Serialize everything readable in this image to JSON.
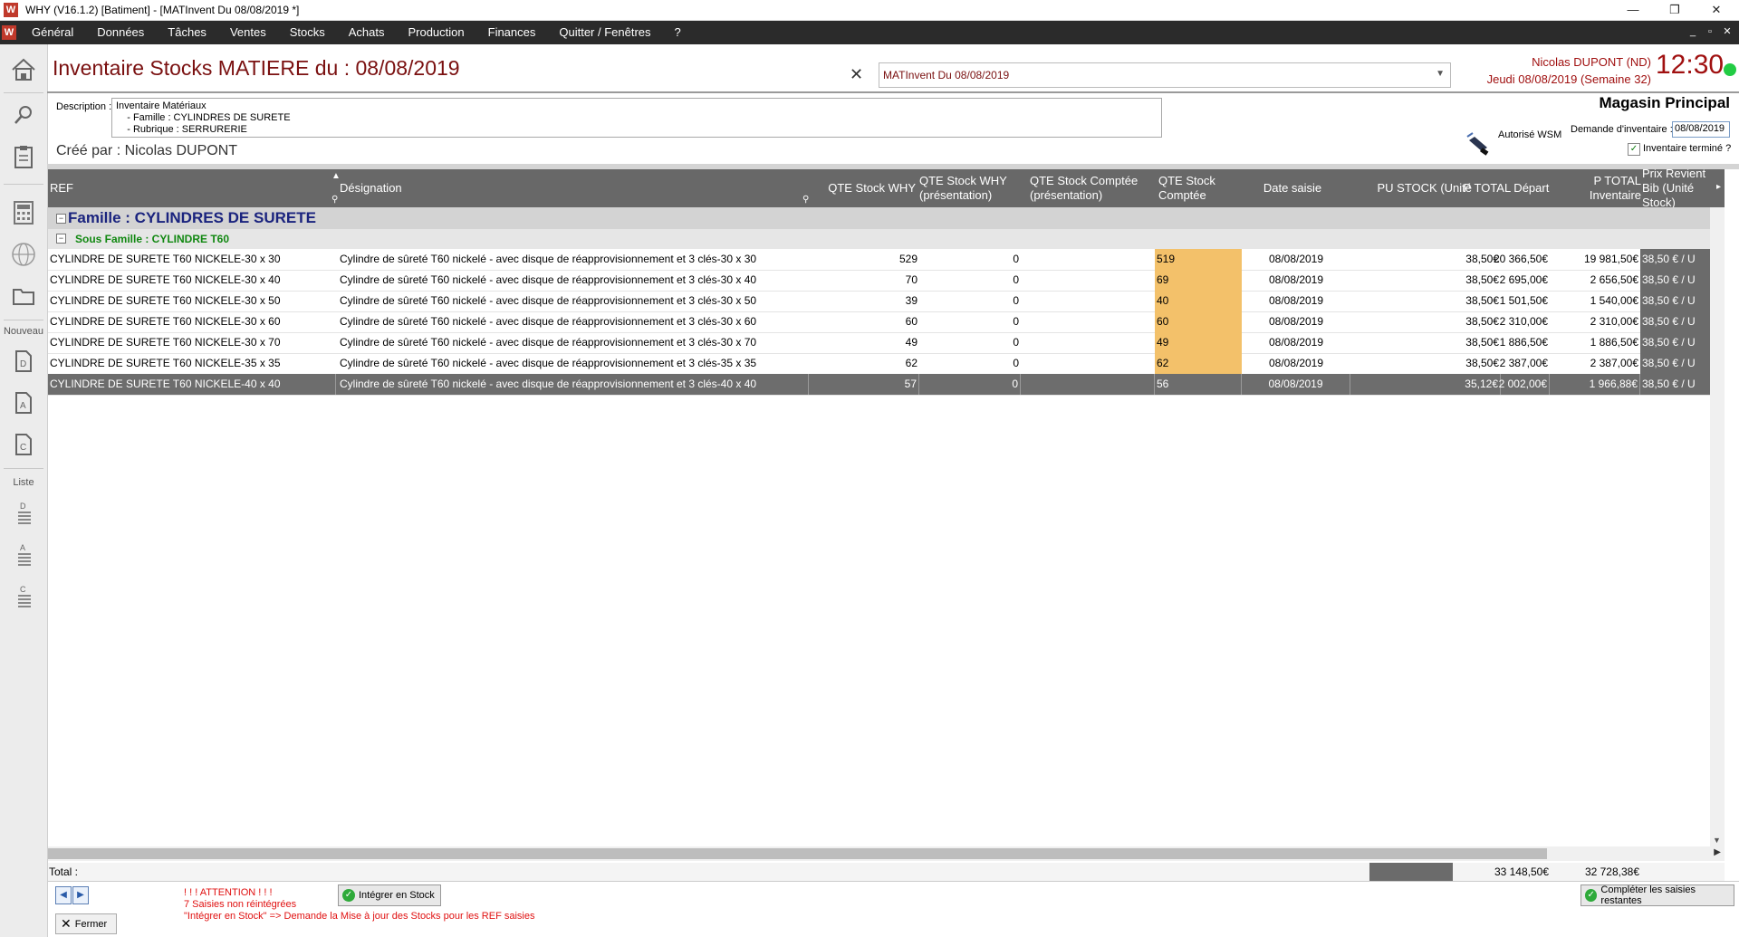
{
  "window": {
    "title": "WHY (V16.1.2)  [Batiment] - [MATInvent Du 08/08/2019 *]",
    "logo": "W",
    "minimize": "—",
    "restore": "❐",
    "close": "✕"
  },
  "menu": {
    "items": [
      "Général",
      "Données",
      "Tâches",
      "Ventes",
      "Stocks",
      "Achats",
      "Production",
      "Finances",
      "Quitter / Fenêtres",
      "?"
    ],
    "ctl_min": "_",
    "ctl_restore": "▫",
    "ctl_close": "✕"
  },
  "sidebar": {
    "nouveau": "Nouveau",
    "liste": "Liste",
    "icons": [
      "home-icon",
      "search-icon",
      "clipboard-icon",
      "calculator-icon",
      "globe-icon",
      "folder-icon",
      "new-doc-d-icon",
      "new-doc-a-icon",
      "new-doc-c-icon",
      "list-d-icon",
      "list-a-icon",
      "list-c-icon"
    ]
  },
  "header": {
    "title": "Inventaire Stocks MATIERE du : 08/08/2019",
    "close_x": "✕",
    "selected_inventory": "MATInvent Du 08/08/2019",
    "user": "Nicolas DUPONT (ND)",
    "date": "Jeudi 08/08/2019 (Semaine 32)",
    "clock": "12:30"
  },
  "info": {
    "description_label": "Description :",
    "description_lines": [
      "Inventaire Matériaux",
      "    - Famille : CYLINDRES DE SURETE",
      "    - Rubrique : SERRURERIE"
    ],
    "created_by": "Créé par : Nicolas DUPONT",
    "magasin": "Magasin Principal",
    "wsm_label": "Autorisé WSM",
    "demande_label": "Demande d'inventaire :",
    "demande_value": "08/08/2019",
    "termine_label": "Inventaire terminé ?",
    "termine_checked": "✓"
  },
  "grid": {
    "columns": [
      {
        "key": "ref",
        "label": "REF"
      },
      {
        "key": "designation",
        "label": "Désignation"
      },
      {
        "key": "qte_why",
        "label": "QTE Stock WHY"
      },
      {
        "key": "qte_why_pres",
        "label": "QTE Stock WHY (présentation)"
      },
      {
        "key": "qte_comptee_pres",
        "label": "QTE Stock Comptée (présentation)"
      },
      {
        "key": "qte_comptee",
        "label": "QTE Stock Comptée"
      },
      {
        "key": "date_saisie",
        "label": "Date saisie"
      },
      {
        "key": "pu_stock",
        "label": "PU STOCK (Unité"
      },
      {
        "key": "p_total_depart",
        "label": "P TOTAL Départ"
      },
      {
        "key": "p_total_inv",
        "label": "P TOTAL Inventaire"
      },
      {
        "key": "prix_revient",
        "label": "Prix Revient Bib (Unité Stock)"
      }
    ],
    "family_label": "Famille : CYLINDRES DE SURETE",
    "subfamily_label": "Sous Famille : CYLINDRE T60",
    "toggle": "−",
    "rows": [
      {
        "ref": "CYLINDRE DE SURETE T60 NICKELE-30 x 30",
        "designation": "Cylindre de sûreté T60 nickelé - avec disque de réapprovisionnement et 3 clés-30 x 30",
        "qte_why": "529",
        "qte_why_pres": "0",
        "qte_comptee_pres": "",
        "qte_comptee": "519",
        "date_saisie": "08/08/2019",
        "pu_stock": "38,50€",
        "p_total_depart": "20 366,50€",
        "p_total_inv": "19 981,50€",
        "prix_revient": "38,50 € / U"
      },
      {
        "ref": "CYLINDRE DE SURETE T60 NICKELE-30 x 40",
        "designation": "Cylindre de sûreté T60 nickelé - avec disque de réapprovisionnement et 3 clés-30 x 40",
        "qte_why": "70",
        "qte_why_pres": "0",
        "qte_comptee_pres": "",
        "qte_comptee": "69",
        "date_saisie": "08/08/2019",
        "pu_stock": "38,50€",
        "p_total_depart": "2 695,00€",
        "p_total_inv": "2 656,50€",
        "prix_revient": "38,50 € / U"
      },
      {
        "ref": "CYLINDRE DE SURETE T60 NICKELE-30 x 50",
        "designation": "Cylindre de sûreté T60 nickelé - avec disque de réapprovisionnement et 3 clés-30 x 50",
        "qte_why": "39",
        "qte_why_pres": "0",
        "qte_comptee_pres": "",
        "qte_comptee": "40",
        "date_saisie": "08/08/2019",
        "pu_stock": "38,50€",
        "p_total_depart": "1 501,50€",
        "p_total_inv": "1 540,00€",
        "prix_revient": "38,50 € / U"
      },
      {
        "ref": "CYLINDRE DE SURETE T60 NICKELE-30 x 60",
        "designation": "Cylindre de sûreté T60 nickelé - avec disque de réapprovisionnement et 3 clés-30 x 60",
        "qte_why": "60",
        "qte_why_pres": "0",
        "qte_comptee_pres": "",
        "qte_comptee": "60",
        "date_saisie": "08/08/2019",
        "pu_stock": "38,50€",
        "p_total_depart": "2 310,00€",
        "p_total_inv": "2 310,00€",
        "prix_revient": "38,50 € / U"
      },
      {
        "ref": "CYLINDRE DE SURETE T60 NICKELE-30 x 70",
        "designation": "Cylindre de sûreté T60 nickelé - avec disque de réapprovisionnement et 3 clés-30 x 70",
        "qte_why": "49",
        "qte_why_pres": "0",
        "qte_comptee_pres": "",
        "qte_comptee": "49",
        "date_saisie": "08/08/2019",
        "pu_stock": "38,50€",
        "p_total_depart": "1 886,50€",
        "p_total_inv": "1 886,50€",
        "prix_revient": "38,50 € / U"
      },
      {
        "ref": "CYLINDRE DE SURETE T60 NICKELE-35 x 35",
        "designation": "Cylindre de sûreté T60 nickelé - avec disque de réapprovisionnement et 3 clés-35 x 35",
        "qte_why": "62",
        "qte_why_pres": "0",
        "qte_comptee_pres": "",
        "qte_comptee": "62",
        "date_saisie": "08/08/2019",
        "pu_stock": "38,50€",
        "p_total_depart": "2 387,00€",
        "p_total_inv": "2 387,00€",
        "prix_revient": "38,50 € / U"
      },
      {
        "ref": "CYLINDRE DE SURETE T60 NICKELE-40 x 40",
        "designation": "Cylindre de sûreté T60 nickelé - avec disque de réapprovisionnement et 3 clés-40 x 40",
        "qte_why": "57",
        "qte_why_pres": "0",
        "qte_comptee_pres": "",
        "qte_comptee": "56",
        "date_saisie": "08/08/2019",
        "pu_stock": "35,12€",
        "p_total_depart": "2 002,00€",
        "p_total_inv": "1 966,88€",
        "prix_revient": "38,50 € / U"
      }
    ]
  },
  "totals": {
    "label": "Total :",
    "p_total_depart": "33 148,50€",
    "p_total_inv": "32 728,38€"
  },
  "footer": {
    "prev": "◀",
    "next": "▶",
    "fermer": "Fermer",
    "fermer_x": "✕",
    "warning_lines": [
      "! ! ! ATTENTION ! ! !",
      "7 Saisies non réintégrées",
      "\"Intégrer en Stock\" => Demande la Mise à jour des Stocks pour les REF saisies"
    ],
    "integrer": "Intégrer en Stock",
    "completer": "Compléter les saisies restantes",
    "ok_glyph": "✓"
  },
  "colors": {
    "title_red": "#7a1010",
    "menu_bg": "#2b2b2b",
    "grid_header": "#686868",
    "highlight_orange": "#f3c16a",
    "family_blue": "#1a237e",
    "subfamily_green": "#118811",
    "warning_red": "#e01010",
    "status_green": "#22cc44"
  }
}
